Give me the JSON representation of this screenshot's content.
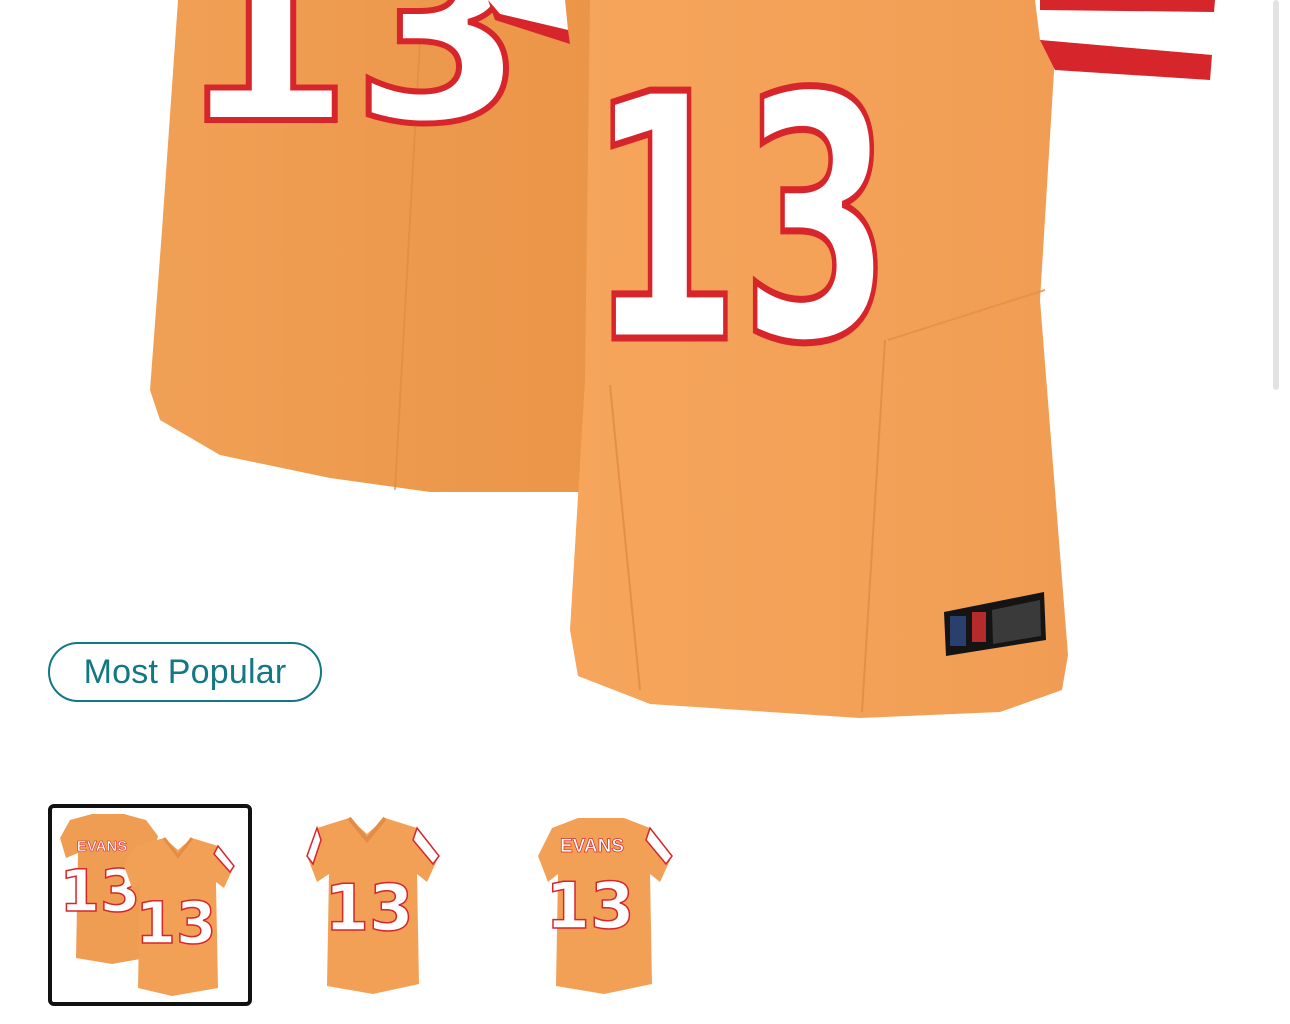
{
  "hero": {
    "number": "13"
  },
  "badge": {
    "label": "Most Popular"
  },
  "thumbnails": [
    {
      "view": "front-and-back",
      "name": "EVANS",
      "number": "13",
      "selected": true
    },
    {
      "view": "front",
      "number": "13",
      "selected": false
    },
    {
      "view": "back",
      "name": "EVANS",
      "number": "13",
      "selected": false
    }
  ],
  "colors": {
    "jersey_orange": "#F3A057",
    "trim_red": "#D7252C",
    "accent_teal": "#137784",
    "selected_border": "#111111"
  }
}
